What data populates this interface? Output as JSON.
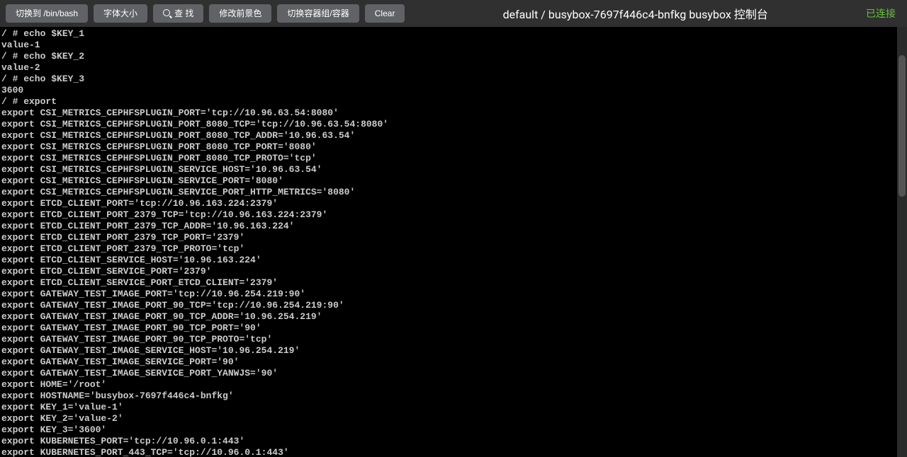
{
  "toolbar": {
    "switch_label": "切换到 /bin/bash",
    "font_label": "字体大小",
    "search_label": "查 找",
    "fgcolor_label": "修改前景色",
    "switch_container_label": "切换容器组/容器",
    "clear_label": "Clear"
  },
  "title": "default / busybox-7697f446c4-bnfkg busybox 控制台",
  "status": "已连接",
  "terminal_lines": [
    "/ # echo $KEY_1",
    "value-1",
    "/ # echo $KEY_2",
    "value-2",
    "/ # echo $KEY_3",
    "3600",
    "/ # export",
    "export CSI_METRICS_CEPHFSPLUGIN_PORT='tcp://10.96.63.54:8080'",
    "export CSI_METRICS_CEPHFSPLUGIN_PORT_8080_TCP='tcp://10.96.63.54:8080'",
    "export CSI_METRICS_CEPHFSPLUGIN_PORT_8080_TCP_ADDR='10.96.63.54'",
    "export CSI_METRICS_CEPHFSPLUGIN_PORT_8080_TCP_PORT='8080'",
    "export CSI_METRICS_CEPHFSPLUGIN_PORT_8080_TCP_PROTO='tcp'",
    "export CSI_METRICS_CEPHFSPLUGIN_SERVICE_HOST='10.96.63.54'",
    "export CSI_METRICS_CEPHFSPLUGIN_SERVICE_PORT='8080'",
    "export CSI_METRICS_CEPHFSPLUGIN_SERVICE_PORT_HTTP_METRICS='8080'",
    "export ETCD_CLIENT_PORT='tcp://10.96.163.224:2379'",
    "export ETCD_CLIENT_PORT_2379_TCP='tcp://10.96.163.224:2379'",
    "export ETCD_CLIENT_PORT_2379_TCP_ADDR='10.96.163.224'",
    "export ETCD_CLIENT_PORT_2379_TCP_PORT='2379'",
    "export ETCD_CLIENT_PORT_2379_TCP_PROTO='tcp'",
    "export ETCD_CLIENT_SERVICE_HOST='10.96.163.224'",
    "export ETCD_CLIENT_SERVICE_PORT='2379'",
    "export ETCD_CLIENT_SERVICE_PORT_ETCD_CLIENT='2379'",
    "export GATEWAY_TEST_IMAGE_PORT='tcp://10.96.254.219:90'",
    "export GATEWAY_TEST_IMAGE_PORT_90_TCP='tcp://10.96.254.219:90'",
    "export GATEWAY_TEST_IMAGE_PORT_90_TCP_ADDR='10.96.254.219'",
    "export GATEWAY_TEST_IMAGE_PORT_90_TCP_PORT='90'",
    "export GATEWAY_TEST_IMAGE_PORT_90_TCP_PROTO='tcp'",
    "export GATEWAY_TEST_IMAGE_SERVICE_HOST='10.96.254.219'",
    "export GATEWAY_TEST_IMAGE_SERVICE_PORT='90'",
    "export GATEWAY_TEST_IMAGE_SERVICE_PORT_YANWJS='90'",
    "export HOME='/root'",
    "export HOSTNAME='busybox-7697f446c4-bnfkg'",
    "export KEY_1='value-1'",
    "export KEY_2='value-2'",
    "export KEY_3='3600'",
    "export KUBERNETES_PORT='tcp://10.96.0.1:443'",
    "export KUBERNETES_PORT_443_TCP='tcp://10.96.0.1:443'"
  ]
}
